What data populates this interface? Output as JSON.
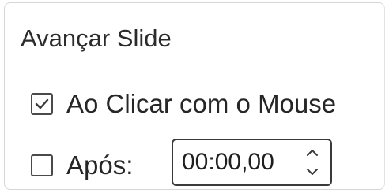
{
  "section": {
    "title": "Avançar Slide"
  },
  "on_click": {
    "label": "Ao Clicar com o Mouse",
    "checked": true
  },
  "after": {
    "label": "Após:",
    "checked": false,
    "value": "00:00,00"
  },
  "icons": {
    "checkmark": "checkmark-icon",
    "up": "chevron-up-icon",
    "down": "chevron-down-icon"
  }
}
